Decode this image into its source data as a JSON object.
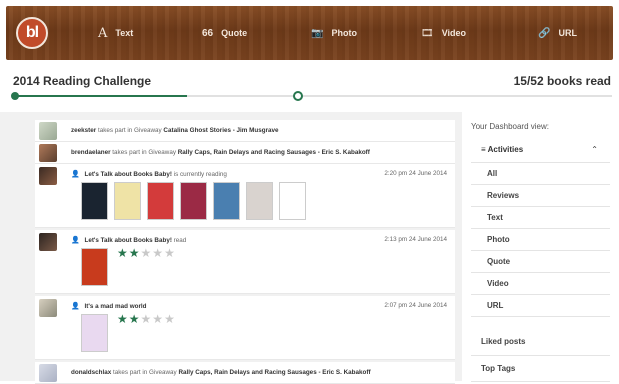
{
  "header": {
    "logo_text": "bl",
    "nav": [
      {
        "label": "Text",
        "icon": "A"
      },
      {
        "label": "Quote",
        "icon": "66"
      },
      {
        "label": "Photo",
        "icon": "📷"
      },
      {
        "label": "Video",
        "icon": "🎞"
      },
      {
        "label": "URL",
        "icon": "🔗"
      }
    ]
  },
  "challenge": {
    "title": "2014 Reading Challenge",
    "count": "15/52 books read",
    "progress": 0.29
  },
  "feed": [
    {
      "type": "giveaway",
      "user": "zeekster",
      "action": "takes part in Giveaway",
      "target": "Catalina Ghost Stories - Jim Musgrave"
    },
    {
      "type": "giveaway",
      "user": "brendaelaner",
      "action": "takes part in Giveaway",
      "target": "Rally Caps, Rain Delays and Racing Sausages - Eric S. Kabakoff"
    },
    {
      "type": "reading",
      "blog": "Let's Talk about Books Baby!",
      "action": "is currently reading",
      "time": "2:20 pm 24 June 2014",
      "covers": [
        "#1a2430",
        "#efe3a6",
        "#d33b3b",
        "#9b2a45",
        "#4a7fb0",
        "#d9d3cf",
        "#ffffff"
      ]
    },
    {
      "type": "read",
      "blog": "Let's Talk about Books Baby!",
      "action": "read",
      "time": "2:13 pm 24 June 2014",
      "rating": 2,
      "covers": [
        "#c83b1d"
      ]
    },
    {
      "type": "read",
      "blog": "It's a mad mad world",
      "action": "read",
      "time": "2:07 pm 24 June 2014",
      "rating": 2,
      "covers": [
        "#e9d9f0"
      ]
    },
    {
      "type": "giveaway",
      "user": "donaldschlax",
      "action": "takes part in Giveaway",
      "target": "Rally Caps, Rain Delays and Racing Sausages - Eric S. Kabakoff"
    }
  ],
  "sidebar": {
    "label": "Your Dashboard view:",
    "section_title": "Activities",
    "items": [
      "All",
      "Reviews",
      "Text",
      "Photo",
      "Quote",
      "Video",
      "URL"
    ],
    "liked": "Liked posts",
    "top_tags": "Top Tags"
  },
  "colors": {
    "accent": "#27764e",
    "wood": "#7a431f"
  }
}
